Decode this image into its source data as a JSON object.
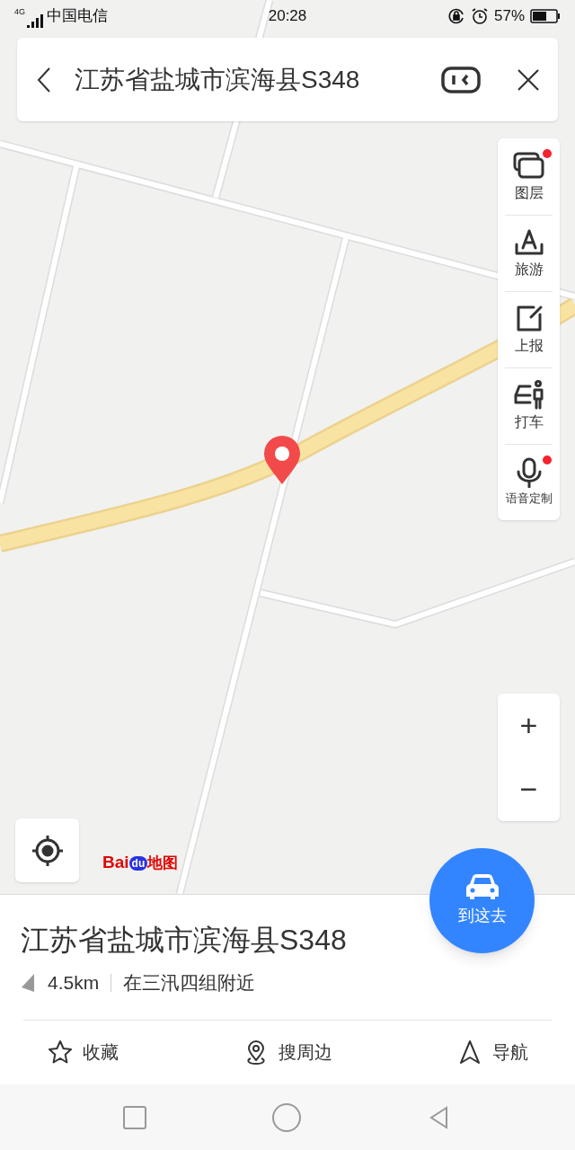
{
  "status_bar": {
    "network": "4G",
    "carrier": "中国电信",
    "time": "20:28",
    "battery": "57%"
  },
  "search_bar": {
    "query": "江苏省盐城市滨海县S348"
  },
  "side_tools": [
    {
      "kind": "layers",
      "label": "图层",
      "badge": true
    },
    {
      "kind": "travel",
      "label": "旅游",
      "badge": false
    },
    {
      "kind": "report",
      "label": "上报",
      "badge": false
    },
    {
      "kind": "taxi",
      "label": "打车",
      "badge": false
    },
    {
      "kind": "voice",
      "label": "语音定制",
      "badge": true
    }
  ],
  "zoom_controls": [
    "+",
    "−"
  ],
  "map_logo": {
    "part_1": "Bai",
    "part_2": "du",
    "part_3": "地图"
  },
  "go_button": {
    "label": "到这去"
  },
  "place": {
    "title": "江苏省盐城市滨海县S348",
    "distance": "4.5km",
    "nearby": "在三汛四组附近"
  },
  "actions": [
    {
      "kind": "star",
      "label": "收藏"
    },
    {
      "kind": "pin",
      "label": "搜周边"
    },
    {
      "kind": "navigate",
      "label": "导航"
    }
  ],
  "nav_bar": [
    {
      "kind": "recents"
    },
    {
      "kind": "home"
    },
    {
      "kind": "back"
    }
  ]
}
